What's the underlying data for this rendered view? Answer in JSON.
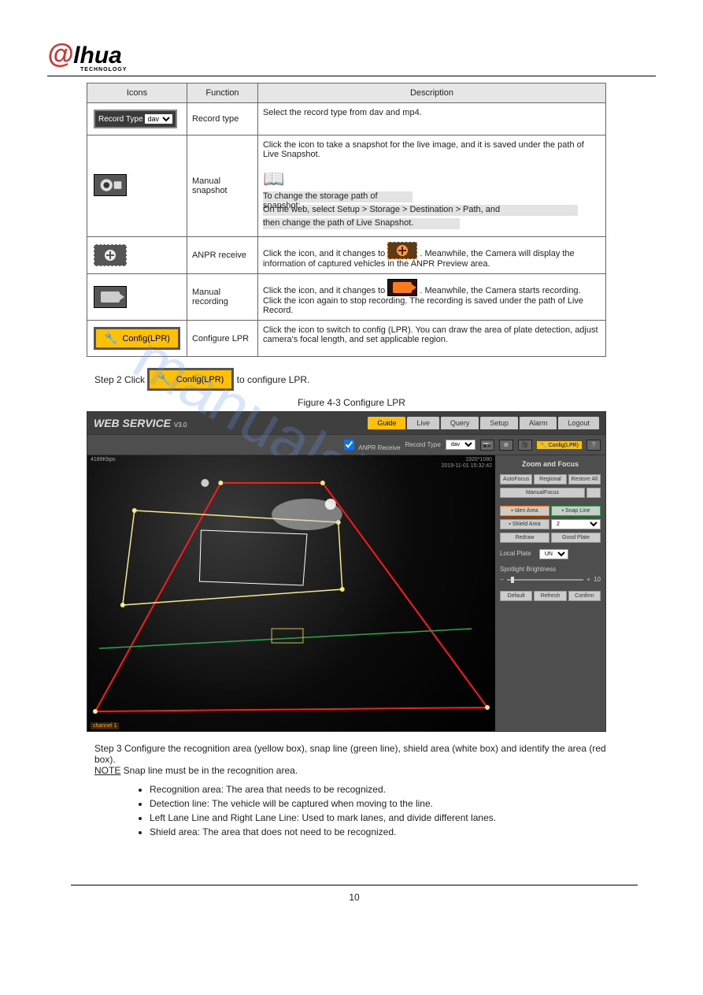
{
  "header": {
    "brand": "alhua",
    "at": "@",
    "brand_rest": "lhua",
    "sub": "TECHNOLOGY"
  },
  "table": {
    "h1": "Icons",
    "h2": "Function",
    "h3": "Description",
    "rows": [
      {
        "fn": "Record type",
        "desc": "Select the record type from dav and mp4.",
        "icon_type": "recordtype",
        "sel": "dav"
      },
      {
        "fn": "Manual snapshot",
        "desc_pre": "Click the icon to take a snapshot for the live image, and it is saved under the path of Live Snapshot.",
        "note1": "To change the storage path of snapshot:",
        "note2": "On the web, select Setup > Storage > Destination > Path, and",
        "note3": "then change the path of Live Snapshot.",
        "icon_type": "manualsnap"
      },
      {
        "fn": "ANPR receive",
        "desc_a": "Click the icon, and it changes to ",
        "desc_b": ". Meanwhile, the Camera will display the information of captured vehicles in the ANPR Preview area.",
        "icon_type": "anpr"
      },
      {
        "fn": "Manual recording",
        "desc_a": "Click the icon, and it changes to ",
        "desc_b": ". Meanwhile, the Camera starts recording. Click the icon again to stop recording. The recording is saved under the path of Live Record.",
        "icon_type": "cam"
      },
      {
        "fn": "Configure LPR",
        "desc": "Click the icon to switch to config (LPR). You can draw the area of plate detection, adjust camera's focal length, and set applicable region.",
        "icon_type": "config",
        "label": "Config(LPR)"
      }
    ]
  },
  "step2": {
    "text_a": "Step 2   Click ",
    "text_b": " to configure LPR.",
    "label": "Config(LPR)"
  },
  "figcap": "Figure 4-3 Configure LPR",
  "webservice": {
    "logo": "WEB  SERVICE",
    "ver": "V3.0",
    "tabs": [
      "Guide",
      "Live",
      "Query",
      "Setup",
      "Alarm",
      "Logout"
    ],
    "active_tab": 0,
    "bar": {
      "anpr": "ANPR Receive",
      "rectype": "Record Type",
      "rectype_sel": "dav",
      "cfg": "Config(LPR)"
    },
    "video": {
      "tl": "4189Kbps",
      "tr1": "1920*1080",
      "tr2": "2019-11-01 15:32:42",
      "bl": "channel 1"
    },
    "side": {
      "title": "Zoom and Focus",
      "r1": [
        "AutoFocus",
        "Regional",
        "Restore All"
      ],
      "r2": "ManualFocus",
      "r3a": "Iden Area",
      "r3b": "Snap Line",
      "r4a": "Shield Area",
      "r4b": "2",
      "r5": [
        "Redraw",
        "Good Plate"
      ],
      "localplate": "Local Plate",
      "localplate_sel": "UN",
      "spot": "Spotlight Brightness",
      "spot_val": "10",
      "r6": [
        "Default",
        "Refresh",
        "Confirm"
      ]
    }
  },
  "step3": {
    "text": "Step 3   Configure the recognition area (yellow box), snap line (green line), shield area (white box) and identify the area (red box).",
    "note_head": "NOTE",
    "note_body": " Snap line must be in the recognition area."
  },
  "bullets": [
    "Recognition area: The area that needs to be recognized.",
    "Detection line: The vehicle will be captured when moving to the line.",
    "Left Lane Line and Right Lane Line: Used to mark lanes, and divide different lanes.",
    "Shield area: The area that does not need to be recognized."
  ],
  "pageno": "10"
}
